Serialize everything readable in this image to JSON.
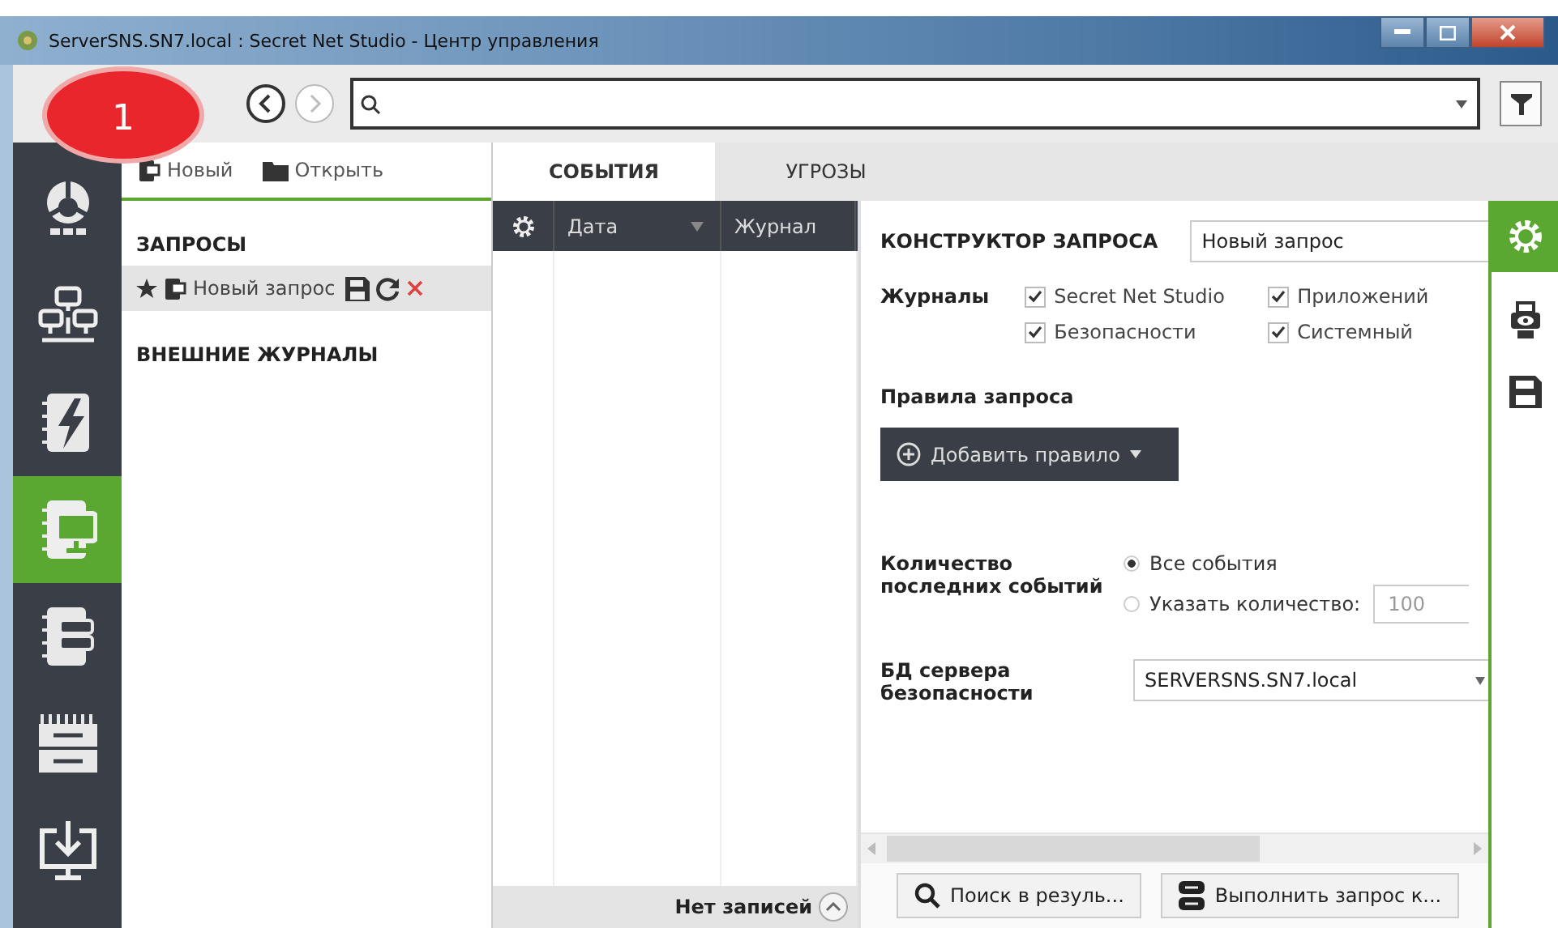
{
  "window": {
    "title": "ServerSNS.SN7.local : Secret Net Studio - Центр управления"
  },
  "badge": "1",
  "sidebar": {
    "items": [
      {
        "kind": "dashboard",
        "selected": false
      },
      {
        "kind": "network",
        "selected": false
      },
      {
        "kind": "alerts",
        "selected": false
      },
      {
        "kind": "queries",
        "selected": true
      },
      {
        "kind": "servers",
        "selected": false
      },
      {
        "kind": "storage",
        "selected": false
      },
      {
        "kind": "download",
        "selected": false
      }
    ]
  },
  "queries_panel": {
    "actions": [
      {
        "kind": "new",
        "label": "Новый"
      },
      {
        "kind": "open",
        "label": "Открыть"
      }
    ],
    "sections": [
      {
        "title": "ЗАПРОСЫ",
        "items": [
          {
            "label": "Новый запрос",
            "selected": true
          }
        ]
      },
      {
        "title": "ВНЕШНИЕ ЖУРНАЛЫ"
      }
    ]
  },
  "tabs": [
    {
      "label": "СОБЫТИЯ",
      "selected": true
    },
    {
      "label": "УГРОЗЫ",
      "selected": false
    }
  ],
  "table": {
    "columns": [
      "Дата",
      "Журнал"
    ],
    "footer": "Нет записей"
  },
  "query_builder": {
    "title": "КОНСТРУКТОР ЗАПРОСА",
    "name": "Новый запрос",
    "logs_label": "Журналы",
    "logs": [
      {
        "label": "Secret Net Studio",
        "checked": true
      },
      {
        "label": "Приложений",
        "checked": true
      },
      {
        "label": "Безопасности",
        "checked": true
      },
      {
        "label": "Системный",
        "checked": true
      }
    ],
    "rules_label": "Правила запроса",
    "add_rule": "Добавить правило",
    "count_label": "Количество последних событий",
    "count_options": [
      {
        "label": "Все события",
        "selected": true
      },
      {
        "label": "Указать количество:",
        "selected": false
      }
    ],
    "count_value": "100",
    "db_label": "БД сервера безопасности",
    "db_value": "SERVERSNS.SN7.local",
    "buttons": [
      {
        "kind": "search",
        "label": "Поиск в резуль..."
      },
      {
        "kind": "run",
        "label": "Выполнить запрос к..."
      }
    ]
  },
  "side_tools": [
    {
      "kind": "settings",
      "selected": true
    },
    {
      "kind": "preview",
      "selected": false
    },
    {
      "kind": "save",
      "selected": false
    }
  ]
}
